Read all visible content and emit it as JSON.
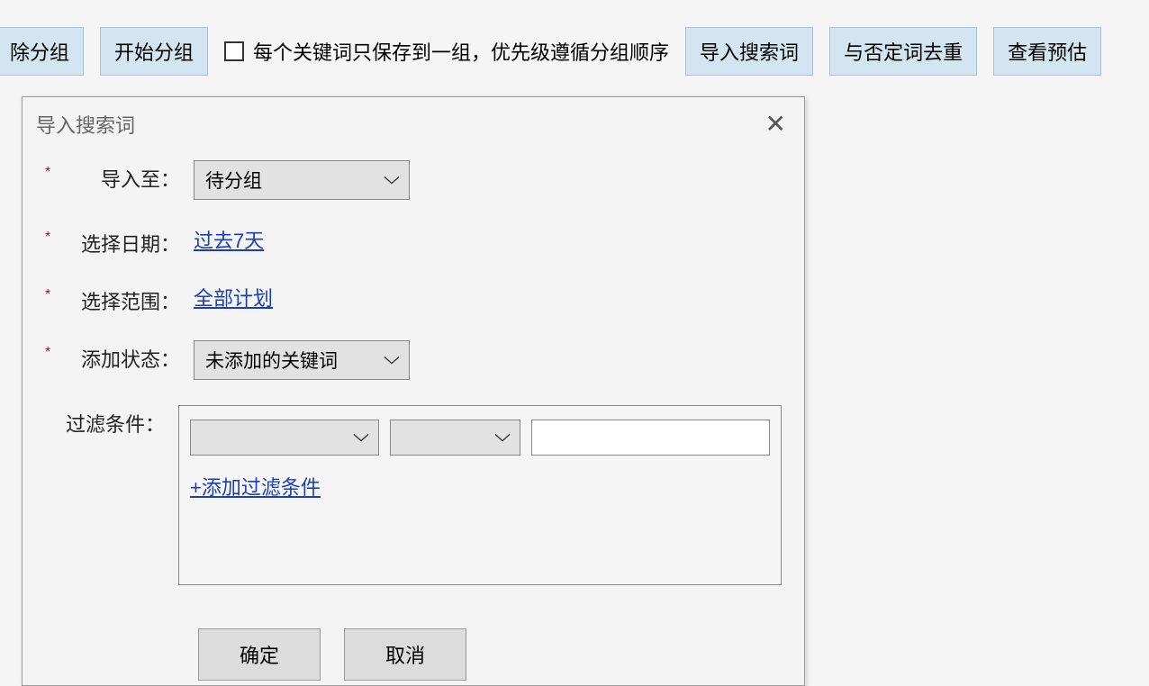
{
  "toolbar": {
    "btn_clear_group": "除分组",
    "btn_start_group": "开始分组",
    "checkbox_label": "每个关键词只保存到一组，优先级遵循分组顺序",
    "btn_import_search": "导入搜索词",
    "btn_dedupe_negatives": "与否定词去重",
    "btn_view_estimate": "查看预估"
  },
  "dialog": {
    "title": "导入搜索词",
    "labels": {
      "import_to": "导入至：",
      "select_date": "选择日期：",
      "select_scope": "选择范围：",
      "add_status": "添加状态：",
      "filter_cond": "过滤条件："
    },
    "values": {
      "import_to_selected": "待分组",
      "date_link": "过去7天",
      "scope_link": "全部计划",
      "status_selected": "未添加的关键词",
      "add_filter_link": "+添加过滤条件"
    },
    "buttons": {
      "ok": "确定",
      "cancel": "取消"
    }
  }
}
